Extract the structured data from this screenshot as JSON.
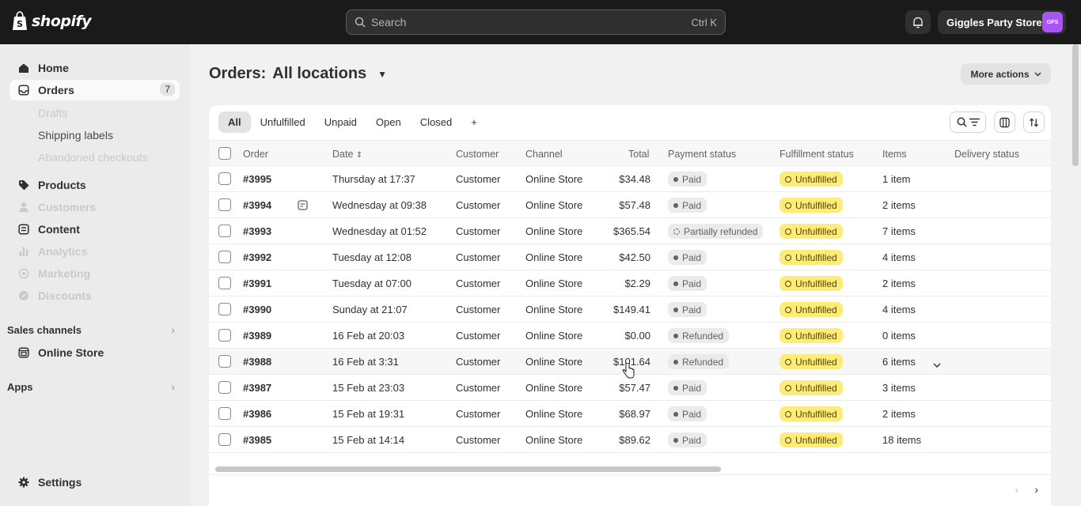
{
  "topbar": {
    "brand": "shopify",
    "search_placeholder": "Search",
    "search_shortcut": "Ctrl K",
    "store_name": "Giggles Party Store",
    "store_initials": "GPS"
  },
  "sidebar": {
    "home": "Home",
    "orders": "Orders",
    "orders_count": "7",
    "drafts": "Drafts",
    "shipping_labels": "Shipping labels",
    "abandoned": "Abandoned checkouts",
    "products": "Products",
    "customers": "Customers",
    "content": "Content",
    "analytics": "Analytics",
    "marketing": "Marketing",
    "discounts": "Discounts",
    "sales_channels": "Sales channels",
    "online_store": "Online Store",
    "apps": "Apps",
    "settings": "Settings"
  },
  "header": {
    "title": "Orders:",
    "location": "All locations",
    "more_actions": "More actions"
  },
  "tabs": [
    "All",
    "Unfulfilled",
    "Unpaid",
    "Open",
    "Closed",
    "+"
  ],
  "columns": {
    "order": "Order",
    "date": "Date",
    "customer": "Customer",
    "channel": "Channel",
    "total": "Total",
    "payment": "Payment status",
    "fulfillment": "Fulfillment status",
    "items": "Items",
    "delivery": "Delivery status"
  },
  "orders": [
    {
      "order": "#3995",
      "date": "Thursday at 17:37",
      "customer": "Customer",
      "channel": "Online Store",
      "total": "$34.48",
      "payment": "Paid",
      "fulfillment": "Unfulfilled",
      "items": "1 item"
    },
    {
      "order": "#3994",
      "date": "Wednesday at 09:38",
      "customer": "Customer",
      "channel": "Online Store",
      "total": "$57.48",
      "payment": "Paid",
      "fulfillment": "Unfulfilled",
      "items": "2 items"
    },
    {
      "order": "#3993",
      "date": "Wednesday at 01:52",
      "customer": "Customer",
      "channel": "Online Store",
      "total": "$365.54",
      "payment": "Partially refunded",
      "fulfillment": "Unfulfilled",
      "items": "7 items"
    },
    {
      "order": "#3992",
      "date": "Tuesday at 12:08",
      "customer": "Customer",
      "channel": "Online Store",
      "total": "$42.50",
      "payment": "Paid",
      "fulfillment": "Unfulfilled",
      "items": "4 items"
    },
    {
      "order": "#3991",
      "date": "Tuesday at 07:00",
      "customer": "Customer",
      "channel": "Online Store",
      "total": "$2.29",
      "payment": "Paid",
      "fulfillment": "Unfulfilled",
      "items": "2 items"
    },
    {
      "order": "#3990",
      "date": "Sunday at 21:07",
      "customer": "Customer",
      "channel": "Online Store",
      "total": "$149.41",
      "payment": "Paid",
      "fulfillment": "Unfulfilled",
      "items": "4 items"
    },
    {
      "order": "#3989",
      "date": "16 Feb at 20:03",
      "customer": "Customer",
      "channel": "Online Store",
      "total": "$0.00",
      "payment": "Refunded",
      "fulfillment": "Unfulfilled",
      "items": "0 items"
    },
    {
      "order": "#3988",
      "date": "16 Feb at 3:31",
      "customer": "Customer",
      "channel": "Online Store",
      "total": "$101.64",
      "payment": "Refunded",
      "fulfillment": "Unfulfilled",
      "items": "6 items"
    },
    {
      "order": "#3987",
      "date": "15 Feb at 23:03",
      "customer": "Customer",
      "channel": "Online Store",
      "total": "$57.47",
      "payment": "Paid",
      "fulfillment": "Unfulfilled",
      "items": "3 items"
    },
    {
      "order": "#3986",
      "date": "15 Feb at 19:31",
      "customer": "Customer",
      "channel": "Online Store",
      "total": "$68.97",
      "payment": "Paid",
      "fulfillment": "Unfulfilled",
      "items": "2 items"
    },
    {
      "order": "#3985",
      "date": "15 Feb at 14:14",
      "customer": "Customer",
      "channel": "Online Store",
      "total": "$89.62",
      "payment": "Paid",
      "fulfillment": "Unfulfilled",
      "items": "18 items"
    }
  ],
  "colors": {
    "topbar": "#1a1a1a",
    "unfulfilled_badge": "#ffeb78",
    "paid_badge": "#ebebeb",
    "avatar": "#a855f7"
  }
}
